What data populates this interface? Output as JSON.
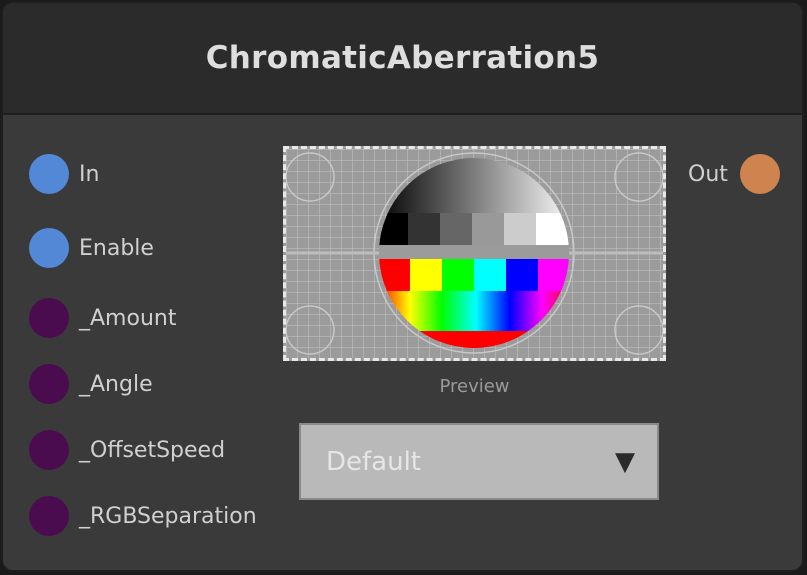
{
  "node": {
    "title": "ChromaticAberration5"
  },
  "inputs": [
    {
      "label": "In",
      "color": "#5388d6"
    },
    {
      "label": "Enable",
      "color": "#5388d6"
    }
  ],
  "params": [
    {
      "label": "_Amount",
      "color": "#4b0b4f"
    },
    {
      "label": "_Angle",
      "color": "#4b0b4f"
    },
    {
      "label": "_OffsetSpeed",
      "color": "#4b0b4f"
    },
    {
      "label": "_RGBSeparation",
      "color": "#4b0b4f"
    }
  ],
  "output": {
    "label": "Out",
    "color": "#cf8450"
  },
  "preview": {
    "caption": "Preview"
  },
  "mode_select": {
    "value": "Default"
  },
  "icons": {
    "dropdown": "▼"
  }
}
